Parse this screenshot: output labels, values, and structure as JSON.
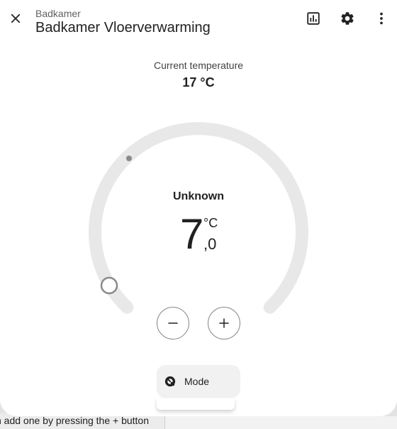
{
  "background": {
    "hint_text": "n add one by pressing the + button"
  },
  "dialog": {
    "breadcrumb": "Badkamer",
    "title": "Badkamer Vloerverwarming",
    "icons": {
      "close": "close-icon",
      "history": "chart-icon",
      "settings": "gear-icon",
      "more": "more-vert-icon"
    }
  },
  "current": {
    "label": "Current temperature",
    "value": "17 °C"
  },
  "thermostat": {
    "status": "Unknown",
    "target_integer": "7",
    "target_decimal": ",0",
    "unit": "°C",
    "decrease_icon": "minus-icon",
    "increase_icon": "plus-icon",
    "slider_level": 0.0
  },
  "mode": {
    "label": "Mode",
    "icon": "thermostat-mode-icon"
  },
  "colors": {
    "track": "#e8e8e8",
    "knob_border": "#8a8a8a",
    "text_primary": "#212121"
  }
}
